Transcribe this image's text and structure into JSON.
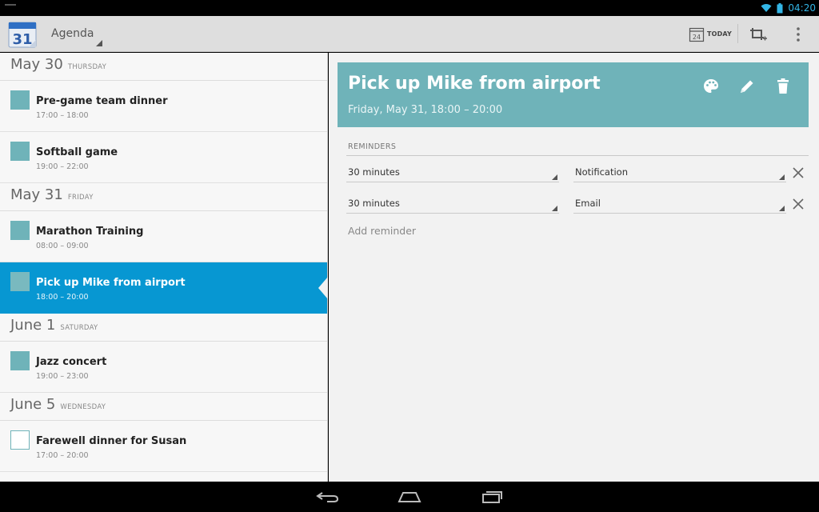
{
  "status": {
    "time": "04:20"
  },
  "app": {
    "icon_day": "31",
    "view_label": "Agenda",
    "today_label": "TODAY",
    "today_icon_day": "24"
  },
  "agenda": {
    "days": [
      {
        "date": "May 30",
        "dow": "THURSDAY",
        "events": [
          {
            "title": "Pre-game team dinner",
            "time": "17:00 – 18:00"
          },
          {
            "title": "Softball game",
            "time": "19:00 – 22:00"
          }
        ]
      },
      {
        "date": "May 31",
        "dow": "FRIDAY",
        "events": [
          {
            "title": "Marathon Training",
            "time": "08:00 – 09:00"
          },
          {
            "title": "Pick up Mike from airport",
            "time": "18:00 – 20:00"
          }
        ]
      },
      {
        "date": "June 1",
        "dow": "SATURDAY",
        "events": [
          {
            "title": "Jazz concert",
            "time": "19:00 – 23:00"
          }
        ]
      },
      {
        "date": "June 5",
        "dow": "WEDNESDAY",
        "events": [
          {
            "title": "Farewell dinner for Susan",
            "time": "17:00 – 20:00"
          }
        ]
      }
    ]
  },
  "detail": {
    "title": "Pick up Mike from airport",
    "when": "Friday, May 31, 18:00 – 20:00",
    "reminders_label": "REMINDERS",
    "reminders": [
      {
        "time": "30 minutes",
        "method": "Notification"
      },
      {
        "time": "30 minutes",
        "method": "Email"
      }
    ],
    "add_reminder": "Add reminder"
  },
  "colors": {
    "event_color": "#6fb3b9",
    "selected_bg": "#0797d2",
    "status_accent": "#33b5e5"
  },
  "icons": [
    "wifi-icon",
    "battery-icon",
    "calendar-app-icon",
    "today-icon",
    "new-event-icon",
    "overflow-icon",
    "palette-icon",
    "edit-icon",
    "delete-icon",
    "close-icon",
    "back-icon",
    "home-icon",
    "recents-icon"
  ]
}
